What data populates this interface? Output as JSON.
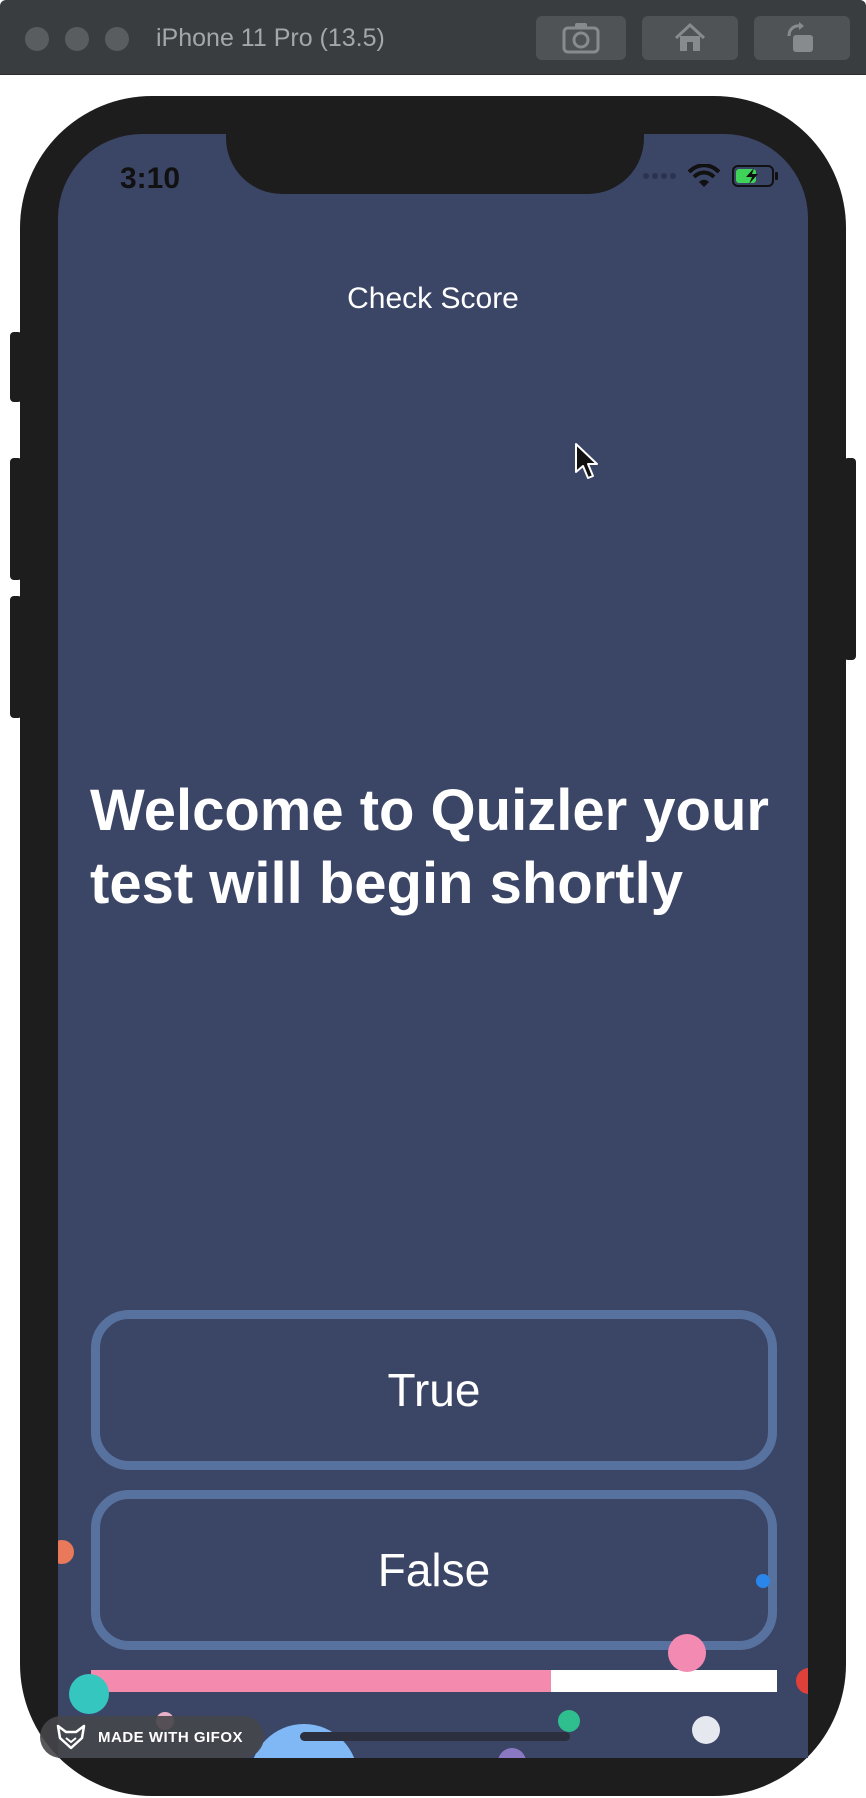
{
  "simulator": {
    "title": "iPhone 11 Pro (13.5)",
    "buttons": [
      "screenshot-icon",
      "home-icon",
      "rotate-icon"
    ]
  },
  "status_bar": {
    "time": "3:10"
  },
  "app": {
    "check_score_label": "Check Score",
    "question": "Welcome to Quizler your test will begin shortly",
    "true_label": "True",
    "false_label": "False",
    "progress": 0.67,
    "colors": {
      "background": "#3b4566",
      "button_border": "#58729f",
      "progress_fill": "#f58aaf",
      "progress_track": "#ffffff"
    }
  },
  "watermark": {
    "label": "MADE WITH GIFOX"
  }
}
